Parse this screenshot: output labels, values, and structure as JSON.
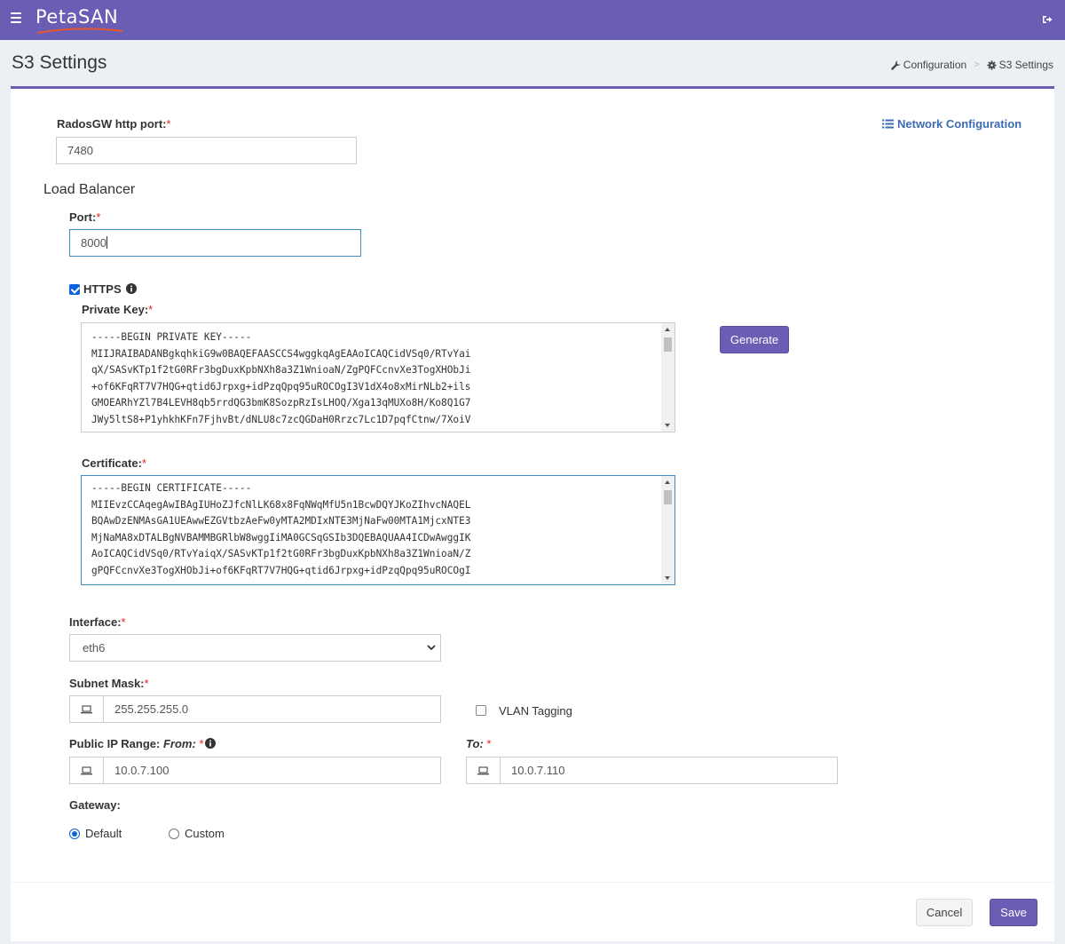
{
  "header": {
    "logo_text": "PetaSAN",
    "brand_color": "#6a5db4",
    "menu_icon": "hamburger-icon",
    "logout_icon": "sign-out-icon"
  },
  "page": {
    "title": "S3 Settings",
    "breadcrumb": [
      {
        "label": "Configuration",
        "icon": "wrench-icon"
      },
      {
        "label": "S3 Settings",
        "icon": "gear-icon"
      }
    ]
  },
  "form": {
    "network_configuration_link": "Network Configuration",
    "radosgw_port": {
      "label": "RadosGW http port:",
      "required": "*",
      "value": "7480"
    },
    "load_balancer": {
      "title": "Load Balancer",
      "port": {
        "label": "Port:",
        "required": "*",
        "value": "8000"
      },
      "https": {
        "label": "HTTPS",
        "checked": true
      },
      "private_key": {
        "label": "Private Key:",
        "required": "*",
        "lines": [
          "-----BEGIN PRIVATE KEY-----",
          "MIIJRAIBADANBgkqhkiG9w0BAQEFAASCCS4wggkqAgEAAoICAQCidVSq0/RTvYai",
          "qX/SASvKTp1f2tG0RFr3bgDuxKpbNXh8a3Z1WnioaN/ZgPQFCcnvXe3TogXHObJi",
          "+of6KFqRT7V7HQG+qtid6Jrpxg+idPzqQpq95uROCOgI3V1dX4o8xMirNLb2+ils",
          "GMOEARhYZl7B4LEVH8qb5rrdQG3bmK8SozpRzIsLHOQ/Xga13qMUXo8H/Ko8Q1G7",
          "JWy5ltS8+P1yhkhKFn7FjhvBt/dNLU8c7zcQGDaH0Rrzc7Lc1D7pqfCtnw/7XoiV"
        ]
      },
      "generate_button": "Generate",
      "certificate": {
        "label": "Certificate:",
        "required": "*",
        "lines": [
          "-----BEGIN CERTIFICATE-----",
          "MIIEvzCCAqegAwIBAgIUHoZJfcNlLK68x8FqNWqMfU5n1BcwDQYJKoZIhvcNAQEL",
          "BQAwDzENMAsGA1UEAwwEZGVtbzAeFw0yMTA2MDIxNTE3MjNaFw00MTA1MjcxNTE3",
          "MjNaMA8xDTALBgNVBAMMBGRlbW8wggIiMA0GCSqGSIb3DQEBAQUAA4ICDwAwggIK",
          "AoICAQCidVSq0/RTvYaiqX/SASvKTp1f2tG0RFr3bgDuxKpbNXh8a3Z1WnioaN/Z",
          "gPQFCcnvXe3TogXHObJi+of6KFqRT7V7HQG+qtid6Jrpxg+idPzqQpq95uROCOgI"
        ]
      },
      "interface": {
        "label": "Interface:",
        "required": "*",
        "value": "eth6"
      },
      "subnet_mask": {
        "label": "Subnet Mask:",
        "required": "*",
        "value": "255.255.255.0"
      },
      "vlan_tagging": {
        "label": "VLAN Tagging",
        "checked": false
      },
      "ip_range": {
        "label": "Public IP Range:",
        "from_label": "From:",
        "to_label": "To:",
        "required": "*",
        "from": "10.0.7.100",
        "to": "10.0.7.110"
      },
      "gateway": {
        "label": "Gateway:",
        "options": [
          "Default",
          "Custom"
        ],
        "selected": "Default"
      }
    }
  },
  "footer": {
    "cancel": "Cancel",
    "save": "Save"
  }
}
